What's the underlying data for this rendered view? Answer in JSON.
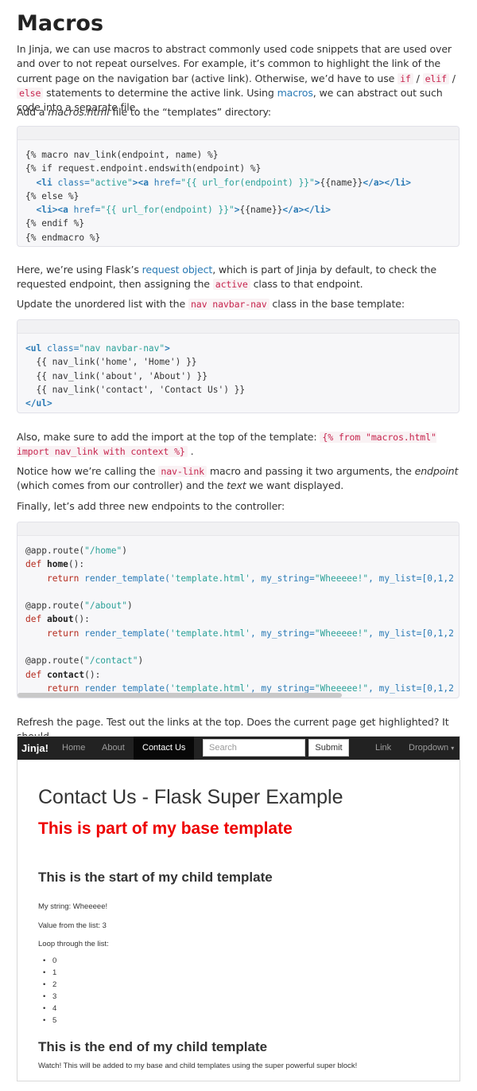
{
  "heading": "Macros",
  "intro": {
    "t1": "In Jinja, we can use macros to abstract commonly used code snippets that are used over and over to not repeat ourselves. For example, it’s common to highlight the link of the current page on the navigation bar (active link). Otherwise, we’d have to use ",
    "c_if": "if",
    "sep1": " / ",
    "c_elif": "elif",
    "sep2": " / ",
    "c_else": "else",
    "t2": " statements to determine the active link. Using ",
    "link_macros": "macros",
    "t3": ", we can abstract out such code into a separate file."
  },
  "add_file": {
    "t1": "Add a ",
    "file": "macros.html",
    "t2": " file to the “templates” directory:"
  },
  "code1": {
    "l1": "{% macro nav_link(endpoint, name) %}",
    "l2": "{% if request.endpoint.endswith(endpoint) %}",
    "l3_pre": "  ",
    "l3_tag1": "<li",
    "l3_attr": " class=",
    "l3_val": "\"active\"",
    "l3_tag2": "><a",
    "l3_attr2": " href=",
    "l3_val2": "\"{{ url_for(endpoint) }}\"",
    "l3_tail": ">",
    "l3_name": "{{name}}",
    "l3_end": "</a></li>",
    "l4": "{% else %}",
    "l5_pre": "  ",
    "l5_tag1": "<li><a",
    "l5_attr": " href=",
    "l5_val": "\"{{ url_for(endpoint) }}\"",
    "l5_tail": ">",
    "l5_name": "{{name}}",
    "l5_end": "</a></li>",
    "l6": "{% endif %}",
    "l7": "{% endmacro %}"
  },
  "here": {
    "t1": "Here, we’re using Flask’s ",
    "link": "request object",
    "t2": ", which is part of Jinja by default, to check the requested endpoint, then assigning the ",
    "c_active": "active",
    "t3": " class to that endpoint."
  },
  "update": {
    "t1": "Update the unordered list with the ",
    "code": "nav navbar-nav",
    "t2": " class in the base template:"
  },
  "code2": {
    "l1_tag": "<ul",
    "l1_attr": " class=",
    "l1_val": "\"nav navbar-nav\"",
    "l1_end": ">",
    "l2": "  {{ nav_link('home', 'Home') }}",
    "l3": "  {{ nav_link('about', 'About') }}",
    "l4": "  {{ nav_link('contact', 'Contact Us') }}",
    "l5": "</ul>"
  },
  "also": {
    "t1": "Also, make sure to add the import at the top of the template: ",
    "code": "{% from \"macros.html\" import nav_link with context %}",
    "t2": " ."
  },
  "notice": {
    "t1": "Notice how we’re calling the ",
    "code": "nav-link",
    "t2": " macro and passing it two arguments, the ",
    "em1": "endpoint",
    "t3": " (which comes from our controller) and the ",
    "em2": "text",
    "t4": " we want displayed."
  },
  "finally": "Finally, let’s add three new endpoints to the controller:",
  "code3": {
    "r1": "@app.route(",
    "r1s": "\"/home\"",
    "r1e": ")",
    "d1k": "def",
    "d1f": "home",
    "d1e": "():",
    "ret": "return",
    "call": " render_template(",
    "arg1": "'template.html'",
    "mid": ", my_string=",
    "arg2": "\"Wheeeee!\"",
    "mid2": ", my_list=[0,1,2",
    "r2": "@app.route(",
    "r2s": "\"/about\"",
    "r2e": ")",
    "d2f": "about",
    "r3": "@app.route(",
    "r3s": "\"/contact\"",
    "r3e": ")",
    "d3f": "contact"
  },
  "refresh": "Refresh the page. Test out the links at the top. Does the current page get highlighted? It should.",
  "demo": {
    "brand": "Jinja!",
    "nav_home": "Home",
    "nav_about": "About",
    "nav_contact": "Contact Us",
    "search_placeholder": "Search",
    "submit": "Submit",
    "nav_link": "Link",
    "nav_dropdown": "Dropdown",
    "caret": "▾",
    "title": "Contact Us - Flask Super Example",
    "base": "This is part of my base template",
    "start": "This is the start of my child template",
    "my_string": "My string: Wheeeee!",
    "value": "Value from the list: 3",
    "loop": "Loop through the list:",
    "items": [
      "0",
      "1",
      "2",
      "3",
      "4",
      "5"
    ],
    "end": "This is the end of my child template",
    "watch": "Watch! This will be added to my base and child templates using the super powerful super block!"
  }
}
